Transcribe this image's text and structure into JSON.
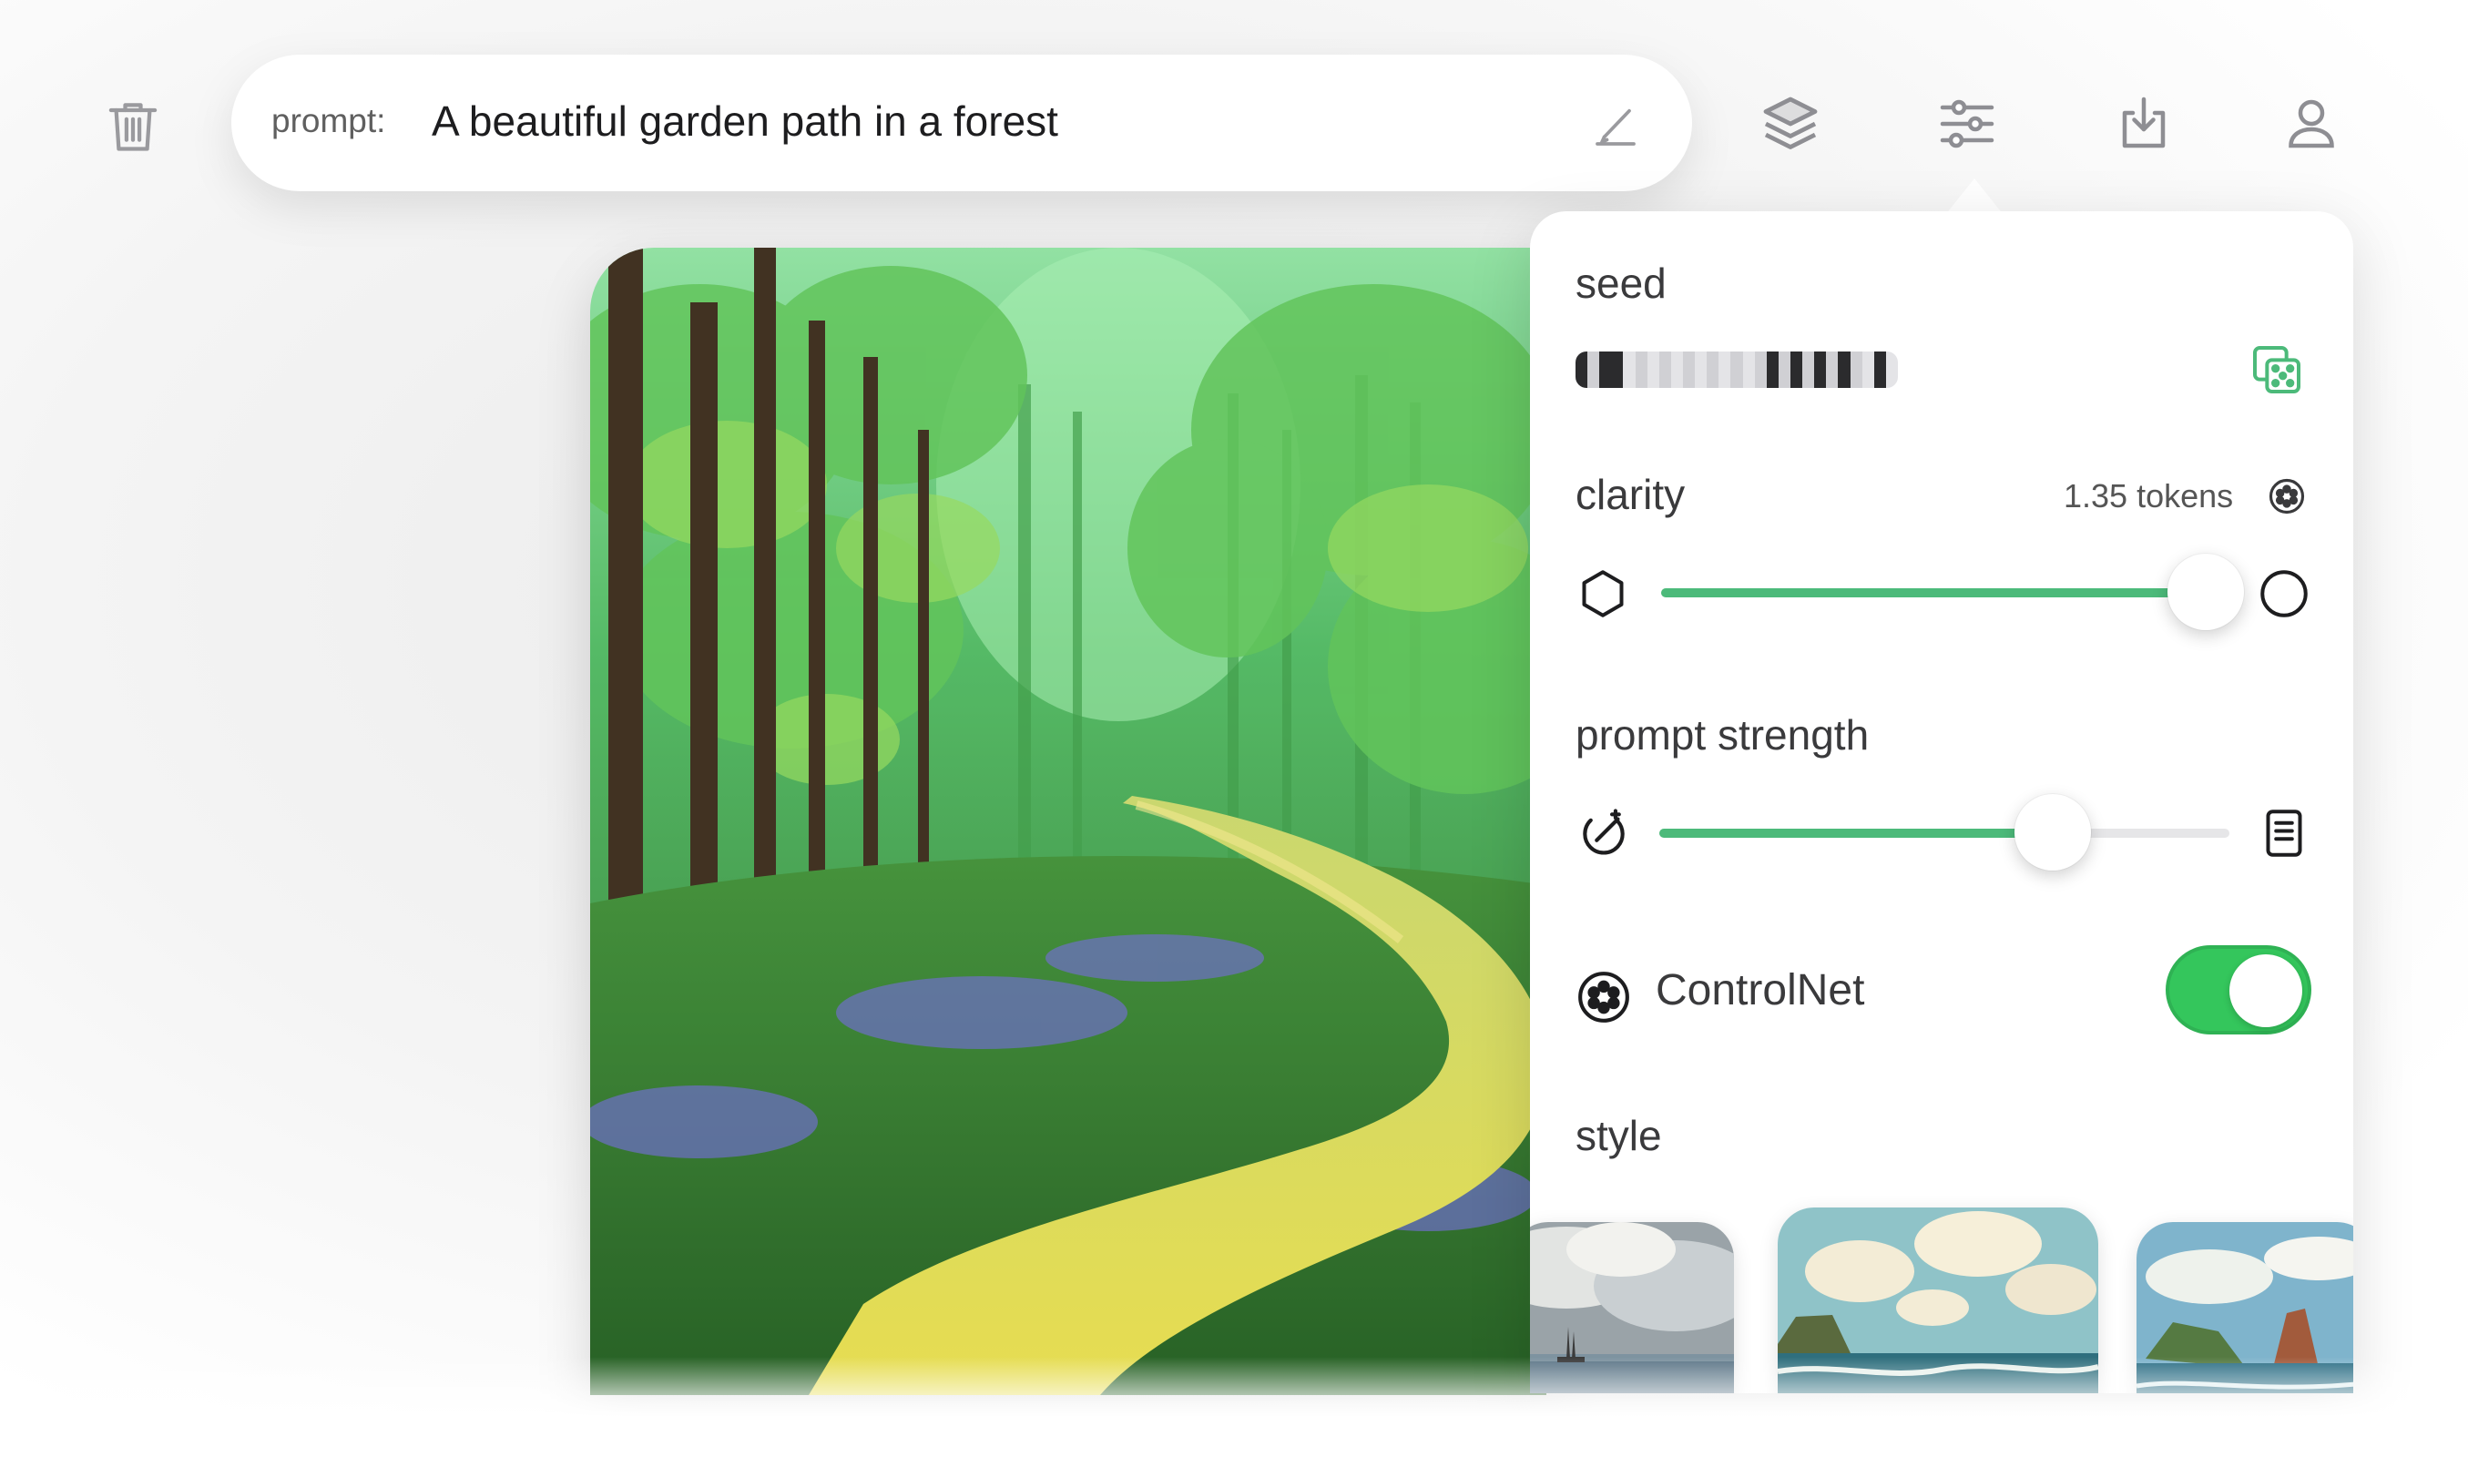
{
  "toolbar": {
    "prompt_label": "prompt:",
    "prompt_value": "A beautiful garden path in a forest",
    "icons": [
      "trash-icon",
      "pen-icon",
      "layers-icon",
      "sliders-icon",
      "download-icon",
      "account-icon"
    ]
  },
  "settings": {
    "seed": {
      "label": "seed",
      "pattern": [
        1,
        0,
        1,
        1,
        0,
        0,
        0,
        0,
        0,
        0,
        0,
        0,
        0,
        0,
        0,
        0,
        1,
        0,
        1,
        0,
        1,
        0,
        1,
        0,
        0,
        1,
        0
      ]
    },
    "clarity": {
      "label": "clarity",
      "tokens": "1.35 tokens",
      "value": 0.97
    },
    "prompt_strength": {
      "label": "prompt strength",
      "value": 0.69
    },
    "controlnet": {
      "label": "ControlNet",
      "enabled": true
    },
    "style": {
      "label": "style",
      "thumbnails": [
        "stormy-sea-ship",
        "cliffs-clouds-sea",
        "sea-rocks"
      ],
      "selected": 1
    }
  },
  "colors": {
    "accent_green": "#4cba7a",
    "toggle_green": "#34c65c",
    "icon_gray": "#8e8e93"
  }
}
